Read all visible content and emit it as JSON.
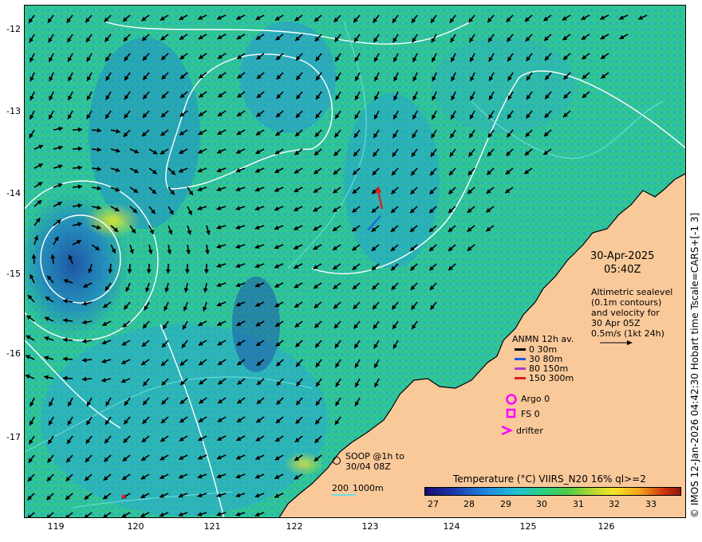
{
  "axes": {
    "lat_ticks": [
      "-12",
      "-13",
      "-14",
      "-15",
      "-16",
      "-17"
    ],
    "lon_ticks": [
      "119",
      "120",
      "121",
      "122",
      "123",
      "124",
      "125",
      "126"
    ]
  },
  "side_caption": "© IMOS 12-Jan-2026 04:42:30 Hobart time Tscale=CARS+[-1 3]",
  "date": "30-Apr-2025",
  "time": "05:40Z",
  "altimetry_text": [
    "Altimetric sealevel",
    "(0.1m contours)",
    "and velocity for",
    "30 Apr 05Z",
    "0.5m/s (1kt 24h)"
  ],
  "anmn": {
    "title": "ANMN 12h av.",
    "items": [
      {
        "label": "0 30m",
        "color": "#000000"
      },
      {
        "label": "30 80m",
        "color": "#1e5be0"
      },
      {
        "label": "80 150m",
        "color": "#b03ad0"
      },
      {
        "label": "150 300m",
        "color": "#e01e1e"
      }
    ]
  },
  "markers": {
    "argo": "Argo 0",
    "fs": "FS 0",
    "drifter": "drifter",
    "marker_color": "#ff00ff"
  },
  "soop": {
    "line1": "SOOP @1h to",
    "line2": "30/04 08Z"
  },
  "depth": {
    "label1": "200",
    "label2": "1000m",
    "color": "#6fe0e0"
  },
  "colorbar": {
    "title": "Temperature (°C) VIIRS_N20 16% ql>=2",
    "ticks": [
      "27",
      "28",
      "29",
      "30",
      "31",
      "32",
      "33"
    ]
  },
  "colors": {
    "land": "#f9c99a",
    "sea": "#2fc0a0",
    "arrow": "#000000"
  }
}
